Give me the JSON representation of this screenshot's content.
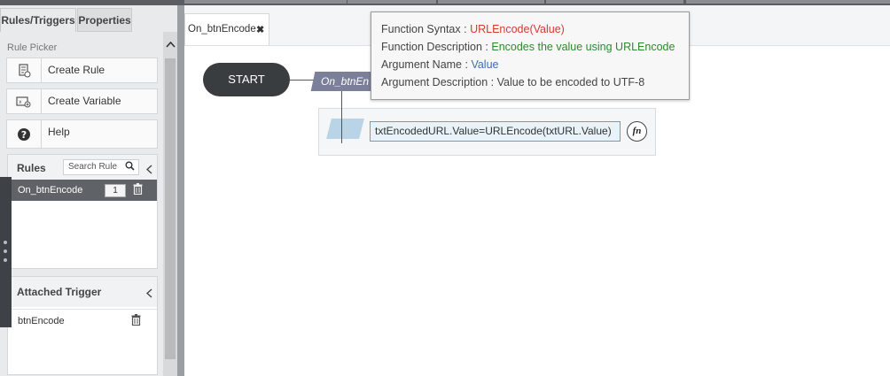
{
  "left_panel": {
    "tabs": [
      "Rules/Triggers",
      "Properties"
    ],
    "rule_picker_title": "Rule Picker",
    "buttons": [
      {
        "label": "Create Rule",
        "icon": "create-rule-icon"
      },
      {
        "label": "Create Variable",
        "icon": "create-variable-icon"
      },
      {
        "label": "Help",
        "icon": "help-icon"
      }
    ],
    "rules_section": {
      "title": "Rules",
      "search_placeholder": "Search Rule",
      "items": [
        {
          "name": "On_btnEncode",
          "count": "1"
        }
      ]
    },
    "trigger_section": {
      "title": "Attached Trigger",
      "items": [
        {
          "name": "btnEncode"
        }
      ]
    }
  },
  "editor": {
    "tab": {
      "label": "On_btnEncode",
      "close": "✖"
    },
    "start_label": "START",
    "rule_label": "On_btnEn",
    "expression": "txtEncodedURL.Value=URLEncode(txtURL.Value)",
    "fn_button": "fn"
  },
  "tooltip": {
    "syntax_label": "Function Syntax : ",
    "syntax_value": "URLEncode(Value)",
    "description_label": "Function Description : ",
    "description_value": "Encodes the value using URLEncode",
    "arg_name_label": "Argument Name : ",
    "arg_name_value": "Value",
    "arg_desc_label": "Argument Description : ",
    "arg_desc_value": "Value to be encoded to UTF-8"
  },
  "colors": {
    "syntax_value": "#d43b2c",
    "description_value": "#2e8a2e",
    "arg_name_value": "#3d6db5",
    "start_node": "#3a3d40",
    "rule_node": "#7b7f99",
    "selected_rule_row": "#5f6266"
  }
}
